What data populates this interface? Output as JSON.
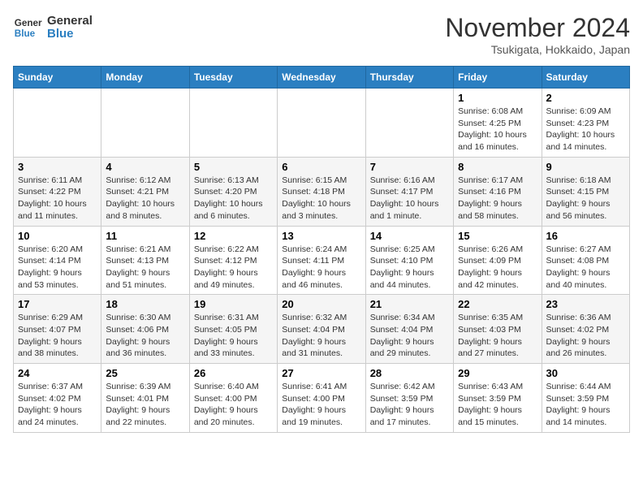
{
  "header": {
    "logo_line1": "General",
    "logo_line2": "Blue",
    "month": "November 2024",
    "location": "Tsukigata, Hokkaido, Japan"
  },
  "days_of_week": [
    "Sunday",
    "Monday",
    "Tuesday",
    "Wednesday",
    "Thursday",
    "Friday",
    "Saturday"
  ],
  "weeks": [
    [
      {
        "day": "",
        "info": ""
      },
      {
        "day": "",
        "info": ""
      },
      {
        "day": "",
        "info": ""
      },
      {
        "day": "",
        "info": ""
      },
      {
        "day": "",
        "info": ""
      },
      {
        "day": "1",
        "info": "Sunrise: 6:08 AM\nSunset: 4:25 PM\nDaylight: 10 hours and 16 minutes."
      },
      {
        "day": "2",
        "info": "Sunrise: 6:09 AM\nSunset: 4:23 PM\nDaylight: 10 hours and 14 minutes."
      }
    ],
    [
      {
        "day": "3",
        "info": "Sunrise: 6:11 AM\nSunset: 4:22 PM\nDaylight: 10 hours and 11 minutes."
      },
      {
        "day": "4",
        "info": "Sunrise: 6:12 AM\nSunset: 4:21 PM\nDaylight: 10 hours and 8 minutes."
      },
      {
        "day": "5",
        "info": "Sunrise: 6:13 AM\nSunset: 4:20 PM\nDaylight: 10 hours and 6 minutes."
      },
      {
        "day": "6",
        "info": "Sunrise: 6:15 AM\nSunset: 4:18 PM\nDaylight: 10 hours and 3 minutes."
      },
      {
        "day": "7",
        "info": "Sunrise: 6:16 AM\nSunset: 4:17 PM\nDaylight: 10 hours and 1 minute."
      },
      {
        "day": "8",
        "info": "Sunrise: 6:17 AM\nSunset: 4:16 PM\nDaylight: 9 hours and 58 minutes."
      },
      {
        "day": "9",
        "info": "Sunrise: 6:18 AM\nSunset: 4:15 PM\nDaylight: 9 hours and 56 minutes."
      }
    ],
    [
      {
        "day": "10",
        "info": "Sunrise: 6:20 AM\nSunset: 4:14 PM\nDaylight: 9 hours and 53 minutes."
      },
      {
        "day": "11",
        "info": "Sunrise: 6:21 AM\nSunset: 4:13 PM\nDaylight: 9 hours and 51 minutes."
      },
      {
        "day": "12",
        "info": "Sunrise: 6:22 AM\nSunset: 4:12 PM\nDaylight: 9 hours and 49 minutes."
      },
      {
        "day": "13",
        "info": "Sunrise: 6:24 AM\nSunset: 4:11 PM\nDaylight: 9 hours and 46 minutes."
      },
      {
        "day": "14",
        "info": "Sunrise: 6:25 AM\nSunset: 4:10 PM\nDaylight: 9 hours and 44 minutes."
      },
      {
        "day": "15",
        "info": "Sunrise: 6:26 AM\nSunset: 4:09 PM\nDaylight: 9 hours and 42 minutes."
      },
      {
        "day": "16",
        "info": "Sunrise: 6:27 AM\nSunset: 4:08 PM\nDaylight: 9 hours and 40 minutes."
      }
    ],
    [
      {
        "day": "17",
        "info": "Sunrise: 6:29 AM\nSunset: 4:07 PM\nDaylight: 9 hours and 38 minutes."
      },
      {
        "day": "18",
        "info": "Sunrise: 6:30 AM\nSunset: 4:06 PM\nDaylight: 9 hours and 36 minutes."
      },
      {
        "day": "19",
        "info": "Sunrise: 6:31 AM\nSunset: 4:05 PM\nDaylight: 9 hours and 33 minutes."
      },
      {
        "day": "20",
        "info": "Sunrise: 6:32 AM\nSunset: 4:04 PM\nDaylight: 9 hours and 31 minutes."
      },
      {
        "day": "21",
        "info": "Sunrise: 6:34 AM\nSunset: 4:04 PM\nDaylight: 9 hours and 29 minutes."
      },
      {
        "day": "22",
        "info": "Sunrise: 6:35 AM\nSunset: 4:03 PM\nDaylight: 9 hours and 27 minutes."
      },
      {
        "day": "23",
        "info": "Sunrise: 6:36 AM\nSunset: 4:02 PM\nDaylight: 9 hours and 26 minutes."
      }
    ],
    [
      {
        "day": "24",
        "info": "Sunrise: 6:37 AM\nSunset: 4:02 PM\nDaylight: 9 hours and 24 minutes."
      },
      {
        "day": "25",
        "info": "Sunrise: 6:39 AM\nSunset: 4:01 PM\nDaylight: 9 hours and 22 minutes."
      },
      {
        "day": "26",
        "info": "Sunrise: 6:40 AM\nSunset: 4:00 PM\nDaylight: 9 hours and 20 minutes."
      },
      {
        "day": "27",
        "info": "Sunrise: 6:41 AM\nSunset: 4:00 PM\nDaylight: 9 hours and 19 minutes."
      },
      {
        "day": "28",
        "info": "Sunrise: 6:42 AM\nSunset: 3:59 PM\nDaylight: 9 hours and 17 minutes."
      },
      {
        "day": "29",
        "info": "Sunrise: 6:43 AM\nSunset: 3:59 PM\nDaylight: 9 hours and 15 minutes."
      },
      {
        "day": "30",
        "info": "Sunrise: 6:44 AM\nSunset: 3:59 PM\nDaylight: 9 hours and 14 minutes."
      }
    ]
  ]
}
